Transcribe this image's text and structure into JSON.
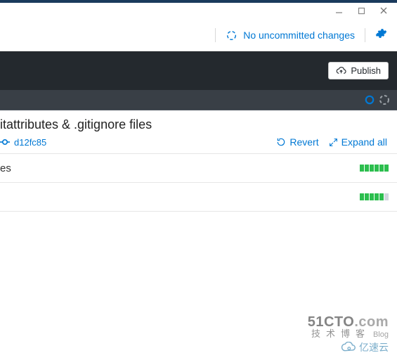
{
  "sync_status": "No uncommitted changes",
  "publish_label": "Publish",
  "commit": {
    "title_visible": "itattributes & .gitignore files",
    "hash": "d12fc85",
    "revert_label": "Revert",
    "expand_label": "Expand all"
  },
  "files": [
    {
      "name_visible": "es",
      "additions": 6,
      "deletions": 0,
      "total_slots": 6
    },
    {
      "name_visible": "",
      "additions": 5,
      "deletions": 0,
      "total_slots": 6
    }
  ],
  "watermark": {
    "line1a": "51CTO",
    "line1b": ".com",
    "line2": "技术博客",
    "line2_small": "Blog",
    "line3": "亿速云"
  }
}
